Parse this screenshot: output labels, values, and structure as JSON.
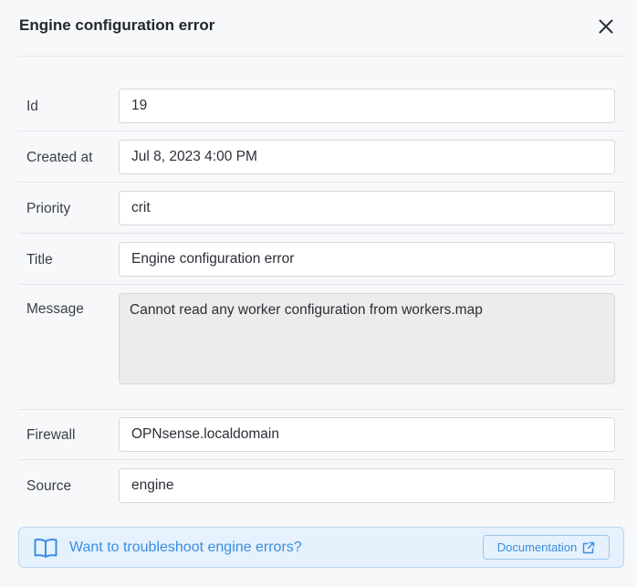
{
  "dialog": {
    "title": "Engine configuration error",
    "close_icon": "close-icon"
  },
  "fields": {
    "id": {
      "label": "Id",
      "value": "19"
    },
    "created_at": {
      "label": "Created at",
      "value": "Jul 8, 2023 4:00 PM"
    },
    "priority": {
      "label": "Priority",
      "value": "crit"
    },
    "title": {
      "label": "Title",
      "value": "Engine configuration error"
    },
    "message": {
      "label": "Message",
      "value": "Cannot read any worker configuration from workers.map"
    },
    "firewall": {
      "label": "Firewall",
      "value": "OPNsense.localdomain"
    },
    "source": {
      "label": "Source",
      "value": "engine"
    }
  },
  "banner": {
    "icon": "book-icon",
    "text": "Want to troubleshoot engine errors?",
    "button_label": "Documentation",
    "button_icon": "external-link-icon"
  },
  "colors": {
    "accent": "#3b8ee0",
    "banner_bg": "#e5f1fc",
    "background": "#f7f8fa"
  }
}
